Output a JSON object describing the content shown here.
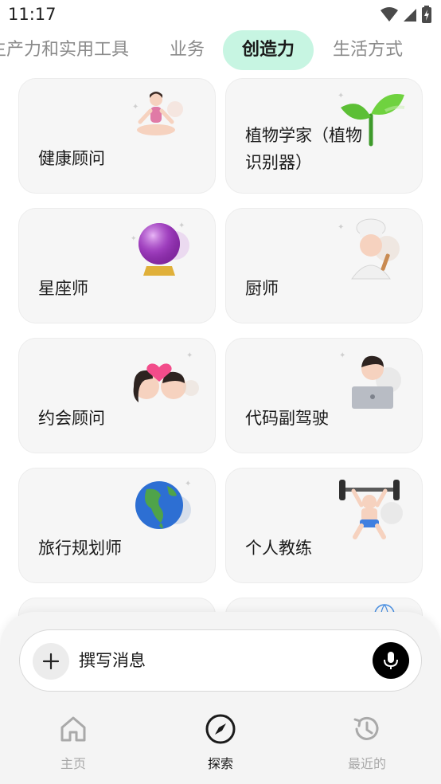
{
  "status_bar": {
    "time": "11:17"
  },
  "tabs": [
    {
      "label": "生产力和实用工具",
      "active": false
    },
    {
      "label": "业务",
      "active": false
    },
    {
      "label": "创造力",
      "active": true
    },
    {
      "label": "生活方式",
      "active": false
    }
  ],
  "cards": [
    {
      "label": "健康顾问",
      "icon": "yoga-person-icon"
    },
    {
      "label": "植物学家（植物识别器）",
      "icon": "seedling-icon"
    },
    {
      "label": "星座师",
      "icon": "crystal-ball-icon"
    },
    {
      "label": "厨师",
      "icon": "chef-icon"
    },
    {
      "label": "约会顾问",
      "icon": "couple-kiss-icon"
    },
    {
      "label": "代码副驾驶",
      "icon": "technologist-laptop-icon"
    },
    {
      "label": "旅行规划师",
      "icon": "globe-americas-icon"
    },
    {
      "label": "个人教练",
      "icon": "weightlifter-icon"
    }
  ],
  "composer": {
    "placeholder": "撰写消息"
  },
  "bottom_nav": [
    {
      "label": "主页",
      "icon": "home-icon",
      "active": false
    },
    {
      "label": "探索",
      "icon": "compass-icon",
      "active": true
    },
    {
      "label": "最近的",
      "icon": "history-icon",
      "active": false
    }
  ],
  "colors": {
    "accent_tab_bg": "#c7f5e2",
    "card_bg": "#f6f6f6",
    "mic_button": "#000000"
  }
}
